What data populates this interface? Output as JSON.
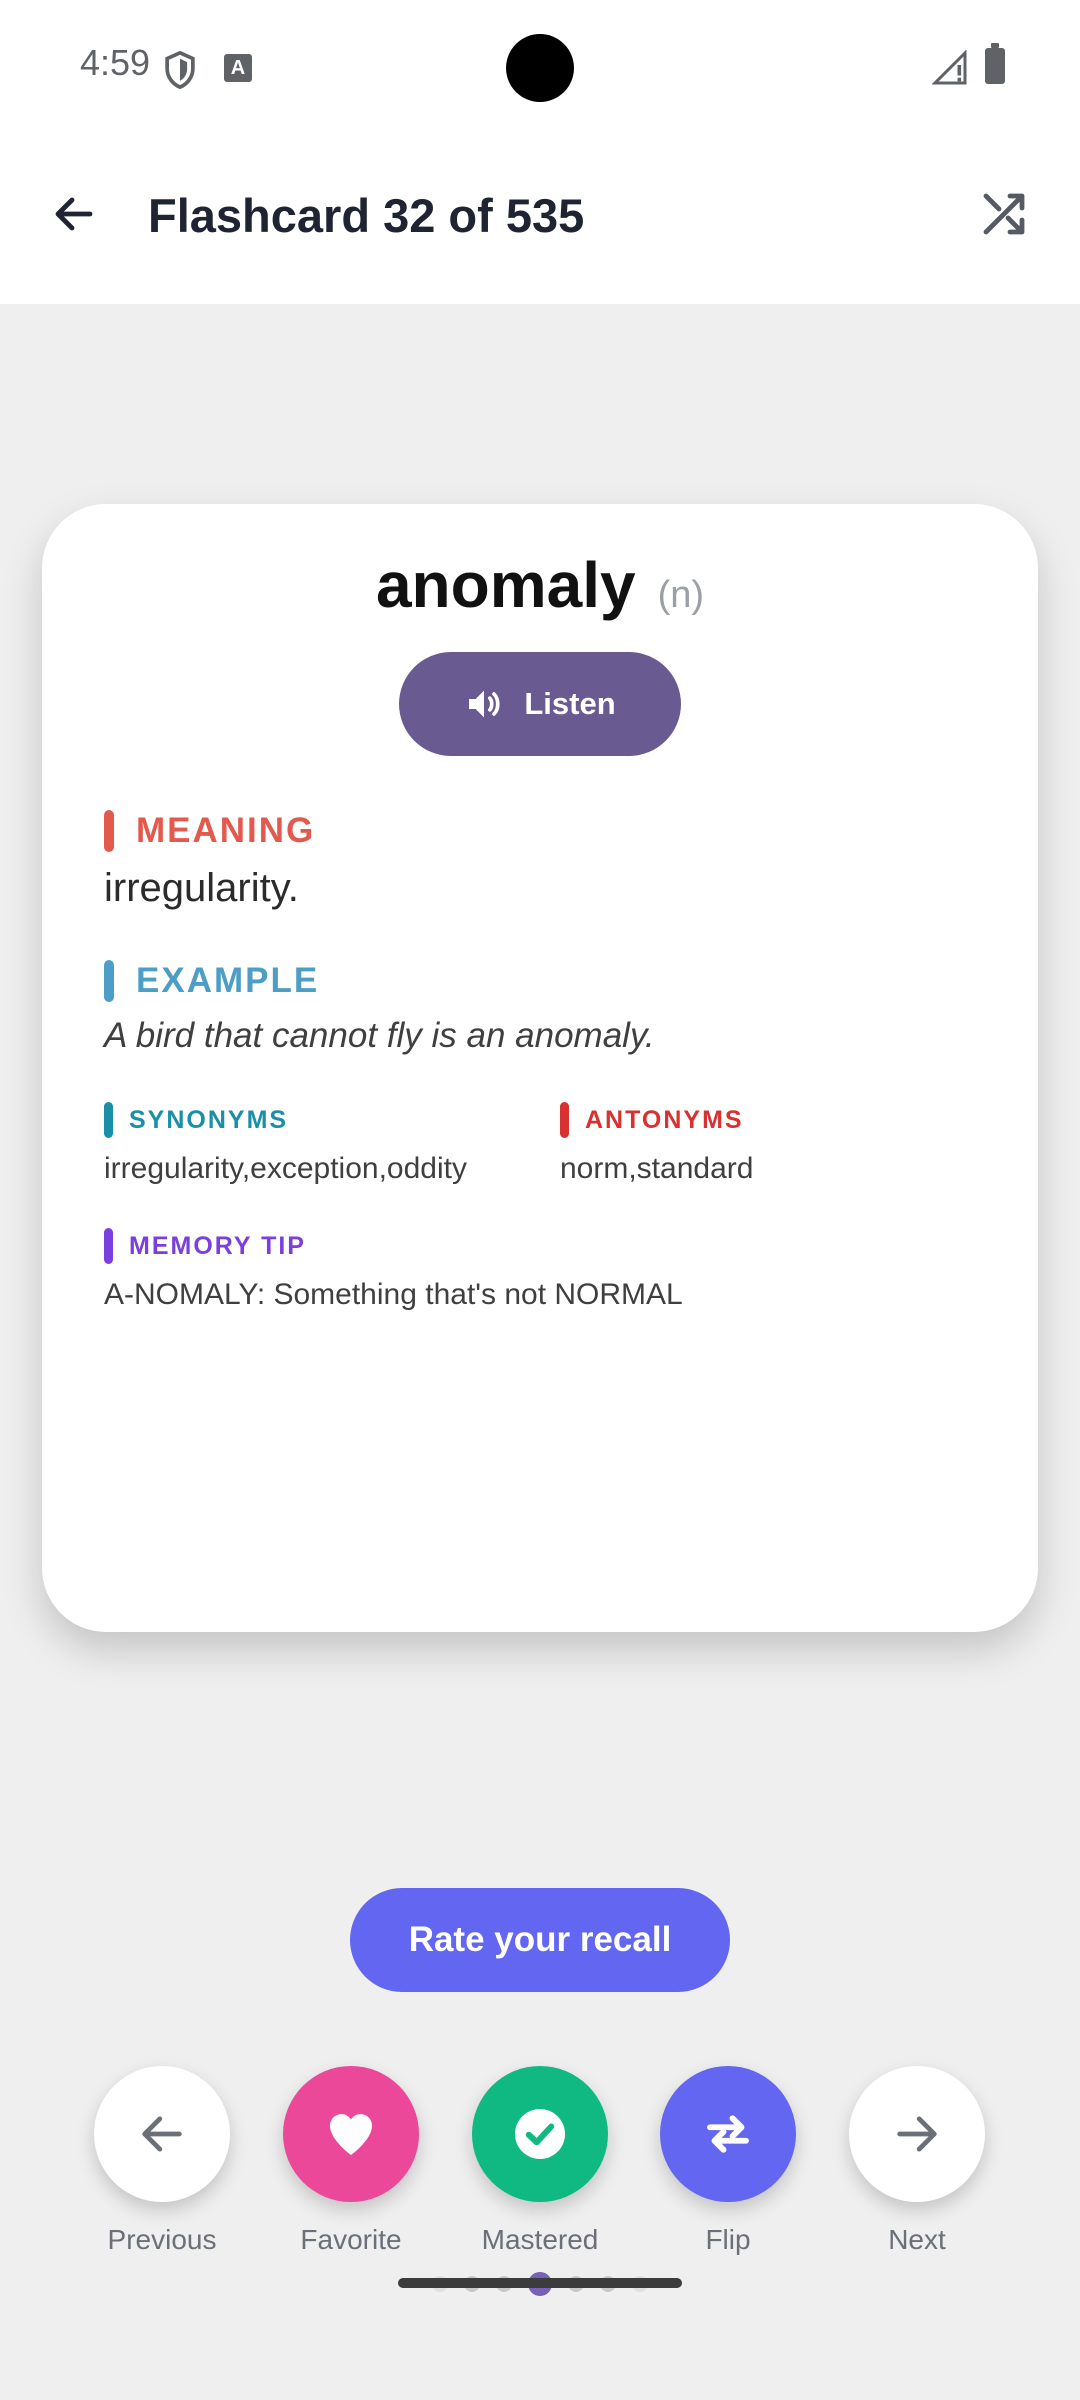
{
  "status_bar": {
    "time": "4:59"
  },
  "app_bar": {
    "title": "Flashcard 32 of 535"
  },
  "card": {
    "word": "anomaly",
    "part_of_speech": "(n)",
    "listen_label": "Listen",
    "meaning_label": "MEANING",
    "meaning": "irregularity.",
    "example_label": "EXAMPLE",
    "example": "A bird that cannot fly is an anomaly.",
    "synonyms_label": "SYNONYMS",
    "synonyms": "irregularity,exception,oddity",
    "antonyms_label": "ANTONYMS",
    "antonyms": "norm,standard",
    "memory_tip_label": "MEMORY TIP",
    "memory_tip": "A-NOMALY: Something that's not NORMAL"
  },
  "rate_button": "Rate your recall",
  "actions": {
    "previous": "Previous",
    "favorite": "Favorite",
    "mastered": "Mastered",
    "flip": "Flip",
    "next": "Next"
  },
  "pagination": {
    "dot_count": 7,
    "active_index": 3
  },
  "colors": {
    "listen": "#6a5a92",
    "meaning": "#e2594d",
    "example": "#4d9ec6",
    "synonyms": "#1a8fa8",
    "antonyms": "#d93030",
    "memory_tip": "#7b3fe0",
    "rate": "#6366f1",
    "favorite": "#ec4899",
    "mastered": "#10b981",
    "flip": "#6366f1"
  },
  "icons": [
    "back-arrow-icon",
    "shuffle-icon",
    "speaker-icon",
    "arrow-left-icon",
    "heart-icon",
    "check-icon",
    "swap-icon",
    "arrow-right-icon"
  ]
}
